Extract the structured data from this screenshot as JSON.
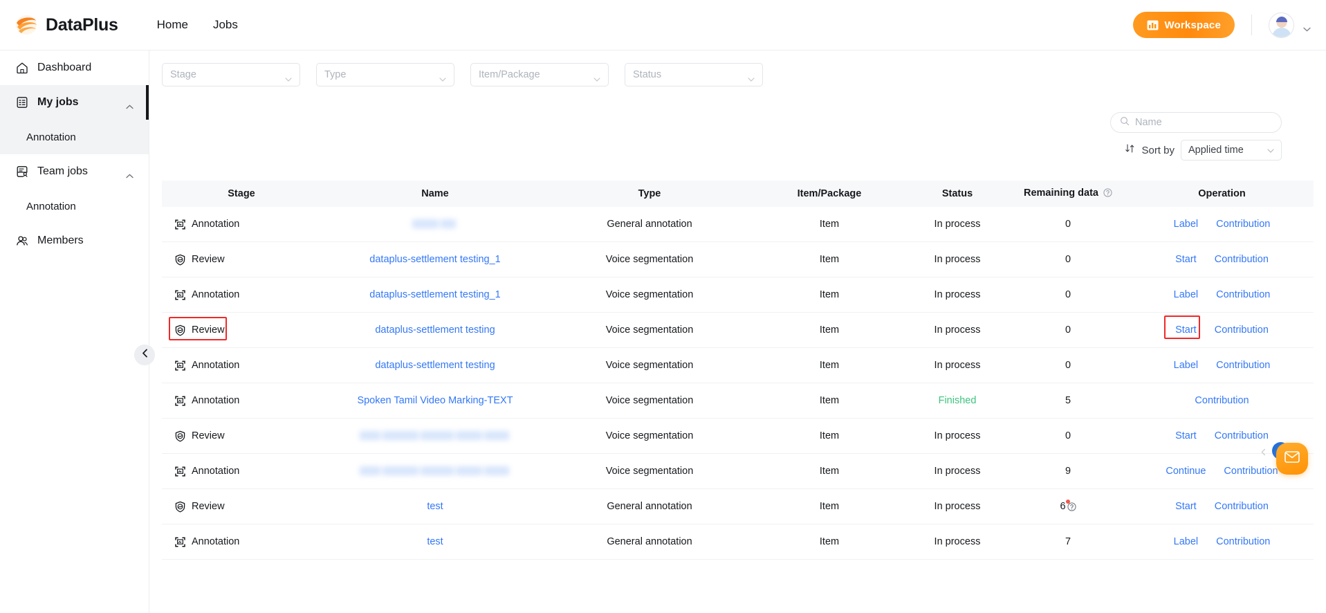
{
  "header": {
    "brand": "DataPlus",
    "nav": [
      {
        "label": "Home"
      },
      {
        "label": "Jobs"
      }
    ],
    "workspace_label": "Workspace"
  },
  "sidebar": {
    "items": [
      {
        "label": "Dashboard",
        "icon": "home-icon",
        "type": "link"
      },
      {
        "label": "My jobs",
        "icon": "clipboard-check-icon",
        "type": "group",
        "active": true
      },
      {
        "label": "Annotation",
        "type": "sub"
      },
      {
        "label": "Team jobs",
        "icon": "clipboard-person-icon",
        "type": "group"
      },
      {
        "label": "Annotation",
        "type": "sub"
      },
      {
        "label": "Members",
        "icon": "users-icon",
        "type": "link"
      }
    ]
  },
  "filters": [
    {
      "name": "stage",
      "placeholder": "Stage"
    },
    {
      "name": "type",
      "placeholder": "Type"
    },
    {
      "name": "item_package",
      "placeholder": "Item/Package"
    },
    {
      "name": "status",
      "placeholder": "Status"
    }
  ],
  "search": {
    "placeholder": "Name",
    "value": ""
  },
  "sort": {
    "label": "Sort by",
    "value": "Applied time"
  },
  "table": {
    "columns": [
      "Stage",
      "Name",
      "Type",
      "Item/Package",
      "Status",
      "Remaining data",
      "Operation"
    ],
    "rows": [
      {
        "stage": "Annotation",
        "stage_icon": "annotation-icon",
        "name": "",
        "name_blurred": true,
        "blur_widths": [
          38,
          22
        ],
        "type": "General annotation",
        "item": "Item",
        "status": "In process",
        "remaining": "0",
        "remaining_alert": false,
        "operations": [
          "Label",
          "Contribution"
        ],
        "highlight_stage": false,
        "highlight_op": null
      },
      {
        "stage": "Review",
        "stage_icon": "review-icon",
        "name": "dataplus-settlement testing_1",
        "name_blurred": false,
        "blur_widths": [],
        "type": "Voice segmentation",
        "item": "Item",
        "status": "In process",
        "remaining": "0",
        "remaining_alert": false,
        "operations": [
          "Start",
          "Contribution"
        ],
        "highlight_stage": false,
        "highlight_op": null
      },
      {
        "stage": "Annotation",
        "stage_icon": "annotation-icon",
        "name": "dataplus-settlement testing_1",
        "name_blurred": false,
        "blur_widths": [],
        "type": "Voice segmentation",
        "item": "Item",
        "status": "In process",
        "remaining": "0",
        "remaining_alert": false,
        "operations": [
          "Label",
          "Contribution"
        ],
        "highlight_stage": false,
        "highlight_op": null
      },
      {
        "stage": "Review",
        "stage_icon": "review-icon",
        "name": "dataplus-settlement testing",
        "name_blurred": false,
        "blur_widths": [],
        "type": "Voice segmentation",
        "item": "Item",
        "status": "In process",
        "remaining": "0",
        "remaining_alert": false,
        "operations": [
          "Start",
          "Contribution"
        ],
        "highlight_stage": true,
        "highlight_op": "Start"
      },
      {
        "stage": "Annotation",
        "stage_icon": "annotation-icon",
        "name": "dataplus-settlement testing",
        "name_blurred": false,
        "blur_widths": [],
        "type": "Voice segmentation",
        "item": "Item",
        "status": "In process",
        "remaining": "0",
        "remaining_alert": false,
        "operations": [
          "Label",
          "Contribution"
        ],
        "highlight_stage": false,
        "highlight_op": null
      },
      {
        "stage": "Annotation",
        "stage_icon": "annotation-icon",
        "name": "Spoken Tamil Video Marking-TEXT",
        "name_blurred": false,
        "blur_widths": [],
        "type": "Voice segmentation",
        "item": "Item",
        "status": "Finished",
        "remaining": "5",
        "remaining_alert": false,
        "operations": [
          "Contribution"
        ],
        "highlight_stage": false,
        "highlight_op": null
      },
      {
        "stage": "Review",
        "stage_icon": "review-icon",
        "name": "",
        "name_blurred": true,
        "blur_widths": [
          30,
          52,
          48,
          38,
          36
        ],
        "type": "Voice segmentation",
        "item": "Item",
        "status": "In process",
        "remaining": "0",
        "remaining_alert": false,
        "operations": [
          "Start",
          "Contribution"
        ],
        "highlight_stage": false,
        "highlight_op": null
      },
      {
        "stage": "Annotation",
        "stage_icon": "annotation-icon",
        "name": "",
        "name_blurred": true,
        "blur_widths": [
          30,
          52,
          48,
          38,
          36
        ],
        "type": "Voice segmentation",
        "item": "Item",
        "status": "In process",
        "remaining": "9",
        "remaining_alert": false,
        "operations": [
          "Continue",
          "Contribution"
        ],
        "highlight_stage": false,
        "highlight_op": null
      },
      {
        "stage": "Review",
        "stage_icon": "review-icon",
        "name": "test",
        "name_blurred": false,
        "blur_widths": [],
        "type": "General annotation",
        "item": "Item",
        "status": "In process",
        "remaining": "6",
        "remaining_alert": true,
        "operations": [
          "Start",
          "Contribution"
        ],
        "highlight_stage": false,
        "highlight_op": null
      },
      {
        "stage": "Annotation",
        "stage_icon": "annotation-icon",
        "name": "test",
        "name_blurred": false,
        "blur_widths": [],
        "type": "General annotation",
        "item": "Item",
        "status": "In process",
        "remaining": "7",
        "remaining_alert": false,
        "operations": [
          "Label",
          "Contribution"
        ],
        "highlight_stage": false,
        "highlight_op": null
      }
    ]
  },
  "pagination": {
    "current_page": "1"
  },
  "colors": {
    "brand_orange": "#ff9505",
    "link_blue": "#3478f6",
    "finished_green": "#3dc47e",
    "highlight_red": "#f02828",
    "page_blue": "#1d70e0"
  }
}
